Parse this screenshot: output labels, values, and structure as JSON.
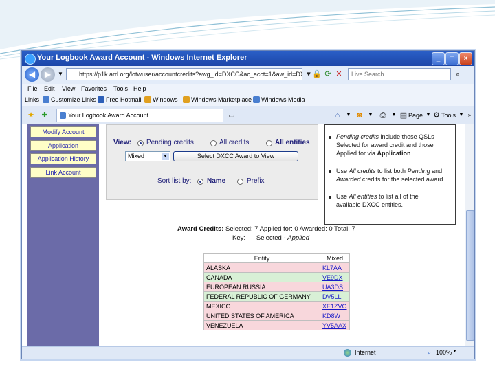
{
  "window": {
    "title": "Your Logbook Award Account - Windows Internet Explorer"
  },
  "address": {
    "url": "https://p1k.arrl.org/lotwuser/accountcredits?awg_id=DXCC&ac_acct=1&aw_id=DXCC",
    "search_placeholder": "Live Search"
  },
  "menu": {
    "items": [
      "File",
      "Edit",
      "View",
      "Favorites",
      "Tools",
      "Help"
    ]
  },
  "links_bar": {
    "label": "Links",
    "items": [
      "Customize Links",
      "Free Hotmail",
      "Windows",
      "Windows Marketplace",
      "Windows Media"
    ]
  },
  "tab": {
    "label": "Your Logbook Award Account"
  },
  "toolbar": {
    "page_label": "Page",
    "tools_label": "Tools"
  },
  "sidebar": {
    "items": [
      {
        "label": "Modify Account"
      },
      {
        "label": "Application"
      },
      {
        "label": "Application History"
      },
      {
        "label": "Link Account"
      }
    ]
  },
  "panel": {
    "view_label": "View:",
    "view_options": [
      {
        "label": "Pending credits",
        "checked": true
      },
      {
        "label": "All credits",
        "checked": false
      },
      {
        "label": "All entities",
        "checked": false
      }
    ],
    "mode_select": "Mixed",
    "select_button": "Select DXCC Award to View",
    "sort_label": "Sort list by:",
    "sort_options": [
      {
        "label": "Name",
        "checked": true
      },
      {
        "label": "Prefix",
        "checked": false
      }
    ]
  },
  "info": {
    "b1": {
      "pre": "Pending credits",
      "l1": " include those QSLs",
      "l2": "Selected for award credit and those",
      "l3": "Applied for via ",
      "l3b": "Application"
    },
    "b2": {
      "l1a": "Use ",
      "l1b": "All credits",
      "l1c": " to list both ",
      "l1d": "Pending",
      "l1e": " and",
      "l2a": "Awarded",
      "l2b": " credits for the selected award."
    },
    "b3": {
      "l1a": "Use ",
      "l1b": "All entities",
      "l1c": " to list all of the",
      "l2": "available DXCC entities."
    }
  },
  "summary": {
    "label": "Award Credits:",
    "text": " Selected: 7 Applied for: 0 Awarded: 0 Total: 7",
    "key_label": "Key:",
    "key_selected": "Selected",
    "key_sep": " - ",
    "key_applied": "Applied"
  },
  "table": {
    "headers": [
      "Entity",
      "Mixed"
    ],
    "rows": [
      {
        "entity": "ALASKA",
        "call": "KL7AA",
        "status": "applied"
      },
      {
        "entity": "CANADA",
        "call": "VE9DX",
        "status": "selected"
      },
      {
        "entity": "EUROPEAN RUSSIA",
        "call": "UA3DS",
        "status": "applied"
      },
      {
        "entity": "FEDERAL REPUBLIC OF GERMANY",
        "call": "DV5LL",
        "status": "selected"
      },
      {
        "entity": "MEXICO",
        "call": "XE1ZVO",
        "status": "applied"
      },
      {
        "entity": "UNITED STATES OF AMERICA",
        "call": "KD8W",
        "status": "applied"
      },
      {
        "entity": "VENEZUELA",
        "call": "YV5AAX",
        "status": "applied"
      }
    ]
  },
  "status": {
    "zone": "Internet",
    "zoom": "100%"
  },
  "colors": {
    "applied": "#f8d7dc",
    "selected": "#d8f0d6",
    "sidebar": "#6b6ba8",
    "button": "#fffec7"
  }
}
